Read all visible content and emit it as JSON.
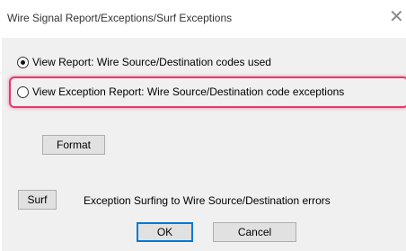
{
  "dialog": {
    "title": "Wire Signal Report/Exceptions/Surf Exceptions",
    "close_symbol": "✕"
  },
  "options": {
    "view_report": {
      "label": "View Report: Wire Source/Destination codes used",
      "checked": true
    },
    "view_exception_report": {
      "label": "View Exception Report: Wire Source/Destination code exceptions",
      "checked": false
    }
  },
  "buttons": {
    "format": "Format",
    "surf": "Surf",
    "ok": "OK",
    "cancel": "Cancel"
  },
  "surf_description": "Exception Surfing to Wire Source/Destination errors",
  "colors": {
    "highlight": "#e8366b",
    "default_button_border": "#0078d7"
  }
}
